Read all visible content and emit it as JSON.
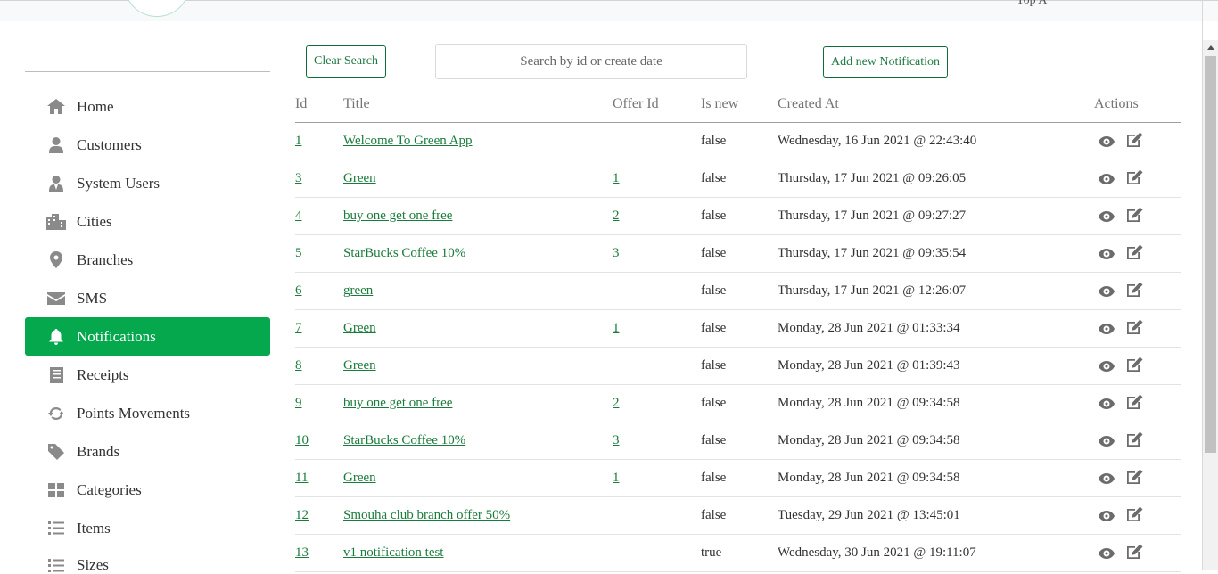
{
  "header": {
    "user_text": "Top A"
  },
  "sidebar": {
    "items": [
      {
        "label": "Home",
        "icon": "home-icon"
      },
      {
        "label": "Customers",
        "icon": "user-icon"
      },
      {
        "label": "System Users",
        "icon": "user-tie-icon"
      },
      {
        "label": "Cities",
        "icon": "city-icon"
      },
      {
        "label": "Branches",
        "icon": "map-marker-icon"
      },
      {
        "label": "SMS",
        "icon": "envelope-icon"
      },
      {
        "label": "Notifications",
        "icon": "bell-icon",
        "active": true
      },
      {
        "label": "Receipts",
        "icon": "receipt-icon"
      },
      {
        "label": "Points Movements",
        "icon": "sync-icon"
      },
      {
        "label": "Brands",
        "icon": "tag-icon"
      },
      {
        "label": "Categories",
        "icon": "grid-icon"
      },
      {
        "label": "Items",
        "icon": "list-icon"
      },
      {
        "label": "Sizes",
        "icon": "list-icon"
      }
    ]
  },
  "toolbar": {
    "clear_search_label": "Clear Search",
    "search_placeholder": "Search by id or create date",
    "add_label": "Add new Notification"
  },
  "table": {
    "columns": [
      "Id",
      "Title",
      "Offer Id",
      "Is new",
      "Created At",
      "Actions"
    ],
    "rows": [
      {
        "id": "1",
        "title": "Welcome To Green App",
        "offer_id": "",
        "is_new": "false",
        "created_at": "Wednesday, 16 Jun 2021 @ 22:43:40"
      },
      {
        "id": "3",
        "title": "Green",
        "offer_id": "1",
        "is_new": "false",
        "created_at": "Thursday, 17 Jun 2021 @ 09:26:05"
      },
      {
        "id": "4",
        "title": "buy one get one free",
        "offer_id": "2",
        "is_new": "false",
        "created_at": "Thursday, 17 Jun 2021 @ 09:27:27"
      },
      {
        "id": "5",
        "title": "StarBucks Coffee 10%",
        "offer_id": "3",
        "is_new": "false",
        "created_at": "Thursday, 17 Jun 2021 @ 09:35:54"
      },
      {
        "id": "6",
        "title": "green",
        "offer_id": "",
        "is_new": "false",
        "created_at": "Thursday, 17 Jun 2021 @ 12:26:07"
      },
      {
        "id": "7",
        "title": "Green",
        "offer_id": "1",
        "is_new": "false",
        "created_at": "Monday, 28 Jun 2021 @ 01:33:34"
      },
      {
        "id": "8",
        "title": "Green",
        "offer_id": "",
        "is_new": "false",
        "created_at": "Monday, 28 Jun 2021 @ 01:39:43"
      },
      {
        "id": "9",
        "title": "buy one get one free",
        "offer_id": "2",
        "is_new": "false",
        "created_at": "Monday, 28 Jun 2021 @ 09:34:58"
      },
      {
        "id": "10",
        "title": "StarBucks Coffee 10%",
        "offer_id": "3",
        "is_new": "false",
        "created_at": "Monday, 28 Jun 2021 @ 09:34:58"
      },
      {
        "id": "11",
        "title": "Green",
        "offer_id": "1",
        "is_new": "false",
        "created_at": "Monday, 28 Jun 2021 @ 09:34:58"
      },
      {
        "id": "12",
        "title": "Smouha club branch offer 50%",
        "offer_id": "",
        "is_new": "false",
        "created_at": "Tuesday, 29 Jun 2021 @ 13:45:01"
      },
      {
        "id": "13",
        "title": "v1 notification test",
        "offer_id": "",
        "is_new": "true",
        "created_at": "Wednesday, 30 Jun 2021 @ 19:11:07"
      }
    ]
  },
  "colors": {
    "accent": "#05a84d",
    "link": "#1a7c3c",
    "icon_gray": "#8a8a8a"
  }
}
